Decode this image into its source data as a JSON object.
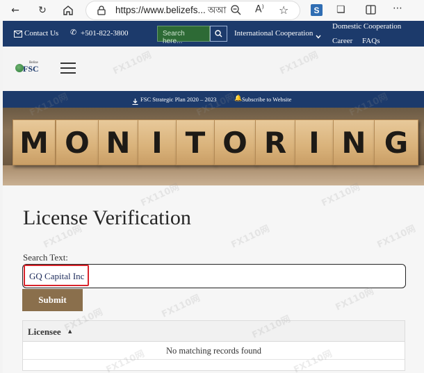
{
  "browser": {
    "url": "https://www.belizefs...",
    "icons": [
      "back-arrow-icon",
      "refresh-icon",
      "home-icon",
      "lock-icon",
      "read-aloud-icon",
      "zoom-out-icon",
      "text-size-icon",
      "favorite-star-icon",
      "s-extension-icon",
      "extensions-icon",
      "split-screen-icon",
      "more-icon"
    ]
  },
  "topnav": {
    "contact": "Contact Us",
    "phone": "+501-822-3800",
    "search_placeholder": "Search here...",
    "intl": "International Cooperation",
    "domestic": "Domestic Cooperation",
    "career": "Career",
    "faqs": "FAQs"
  },
  "logo": {
    "small": "Belize",
    "main": "FSC"
  },
  "announce": {
    "plan": "FSC Strategic Plan 2020 – 2023",
    "subscribe": "Subscribe to Website"
  },
  "banner": {
    "letters": [
      "M",
      "O",
      "N",
      "I",
      "T",
      "O",
      "R",
      "I",
      "N",
      "G"
    ]
  },
  "main": {
    "title": "License Verification",
    "search_label": "Search Text:",
    "search_value": "GQ Capital Inc",
    "submit": "Submit",
    "table": {
      "column": "Licensee",
      "empty": "No matching records found"
    }
  },
  "colors": {
    "navy": "#1c3a6b",
    "submit": "#8a6f4c",
    "highlight": "#d8242b"
  },
  "watermark": "FX110网"
}
